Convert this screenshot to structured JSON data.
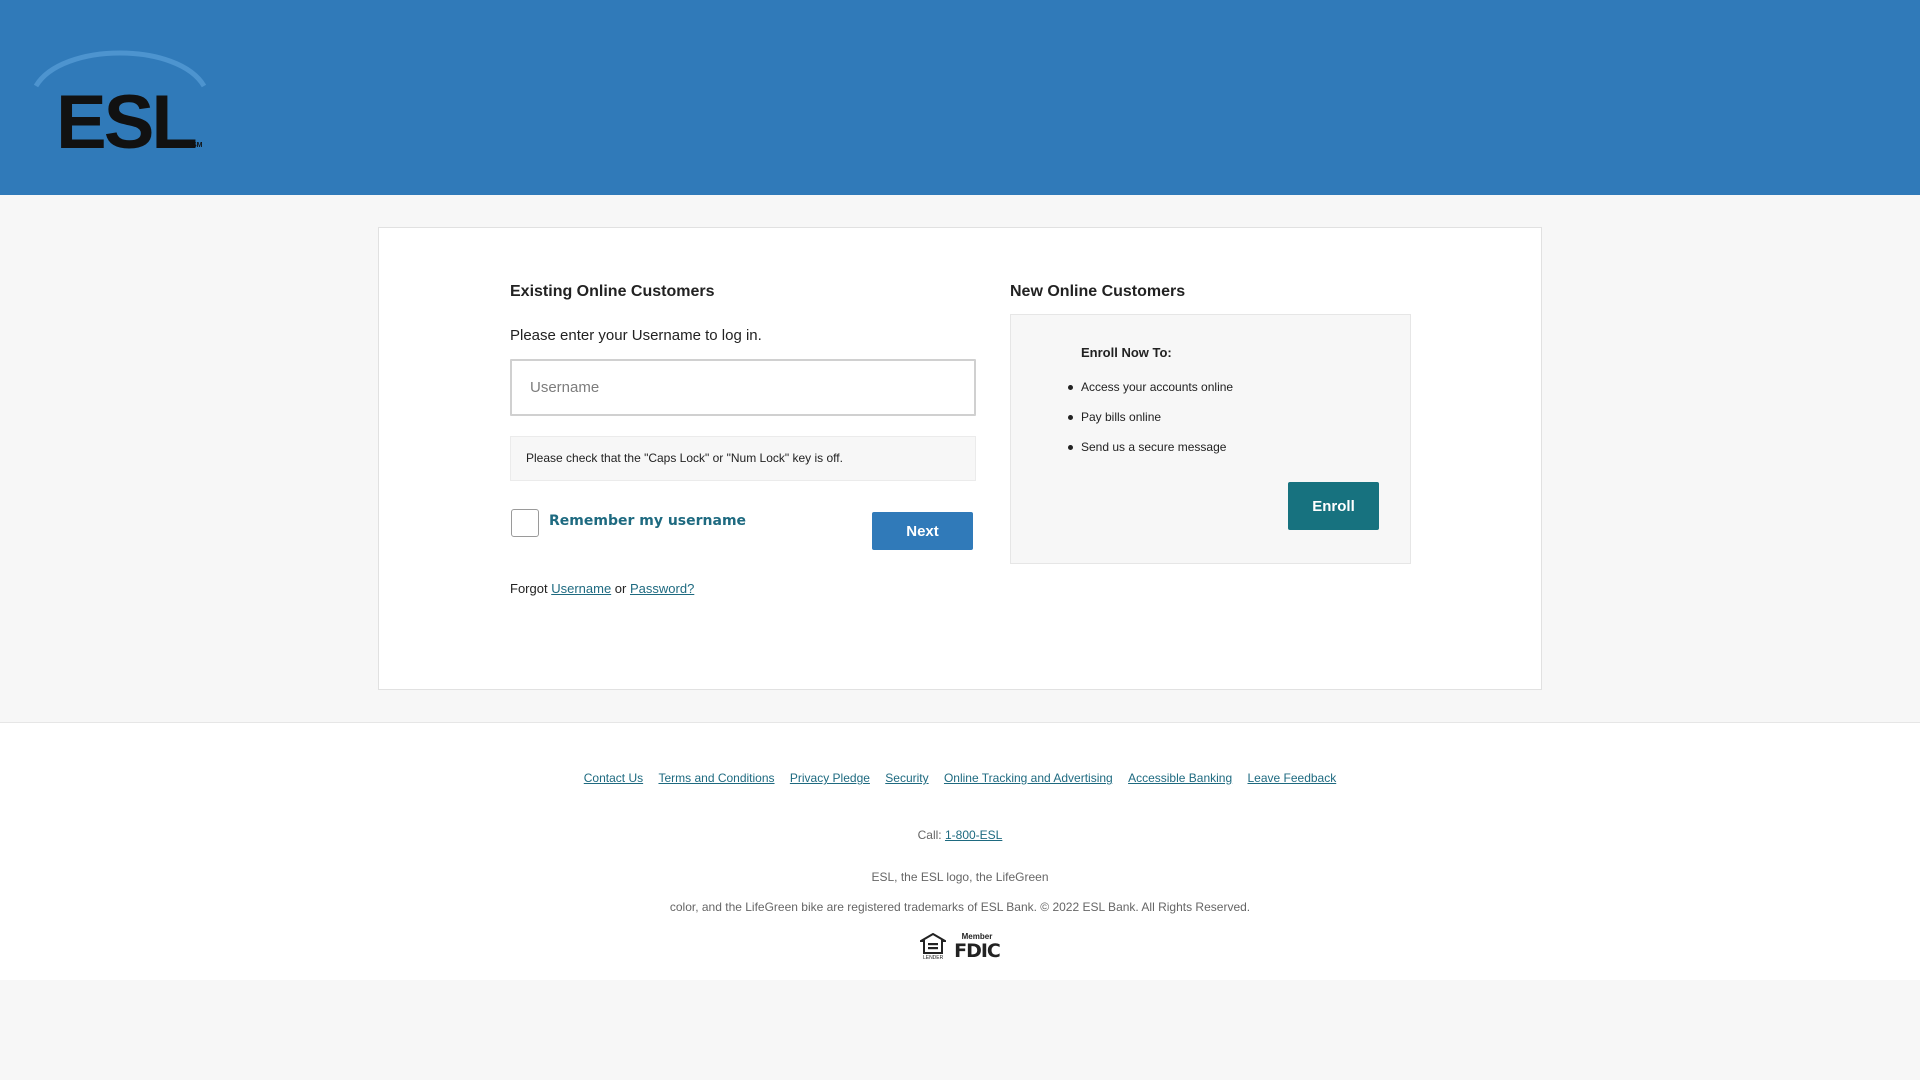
{
  "header": {
    "logo_text": "ESL",
    "logo_mark": "SM",
    "brand_color": "#307ab9"
  },
  "existing": {
    "title": "Existing Online Customers",
    "prompt": "Please enter your Username to log in.",
    "username_placeholder": "Username",
    "username_value": "",
    "caps_note": "Please check that the \"Caps Lock\" or \"Num Lock\" key is off.",
    "remember_label": "Remember my username",
    "remember_checked": false,
    "next_label": "Next",
    "forgot_prefix": "Forgot",
    "forgot_username": "Username",
    "forgot_or": "or",
    "forgot_password": "Password?"
  },
  "new_customers": {
    "title": "New Online Customers",
    "enroll_heading": "Enroll Now To:",
    "items": [
      "Access your accounts online",
      "Pay bills online",
      "Send us a secure message"
    ],
    "enroll_label": "Enroll",
    "enroll_color": "#17727f"
  },
  "footer": {
    "links": [
      "Contact Us",
      "Terms and Conditions",
      "Privacy Pledge",
      "Security",
      "Online Tracking and Advertising",
      "Accessible Banking",
      "Leave Feedback"
    ],
    "call_prefix": "Call:",
    "phone": "1-800-ESL",
    "legal_line1": "ESL, the ESL logo, the LifeGreen",
    "legal_line2": "color, and the LifeGreen bike are registered trademarks of ESL Bank. © 2022 ESL Bank. All Rights Reserved.",
    "badges": {
      "ehl_icon": "equal-housing-lender-icon",
      "ehl_text": "LENDER",
      "fdic_member": "Member",
      "fdic_main": "FDIC"
    }
  }
}
